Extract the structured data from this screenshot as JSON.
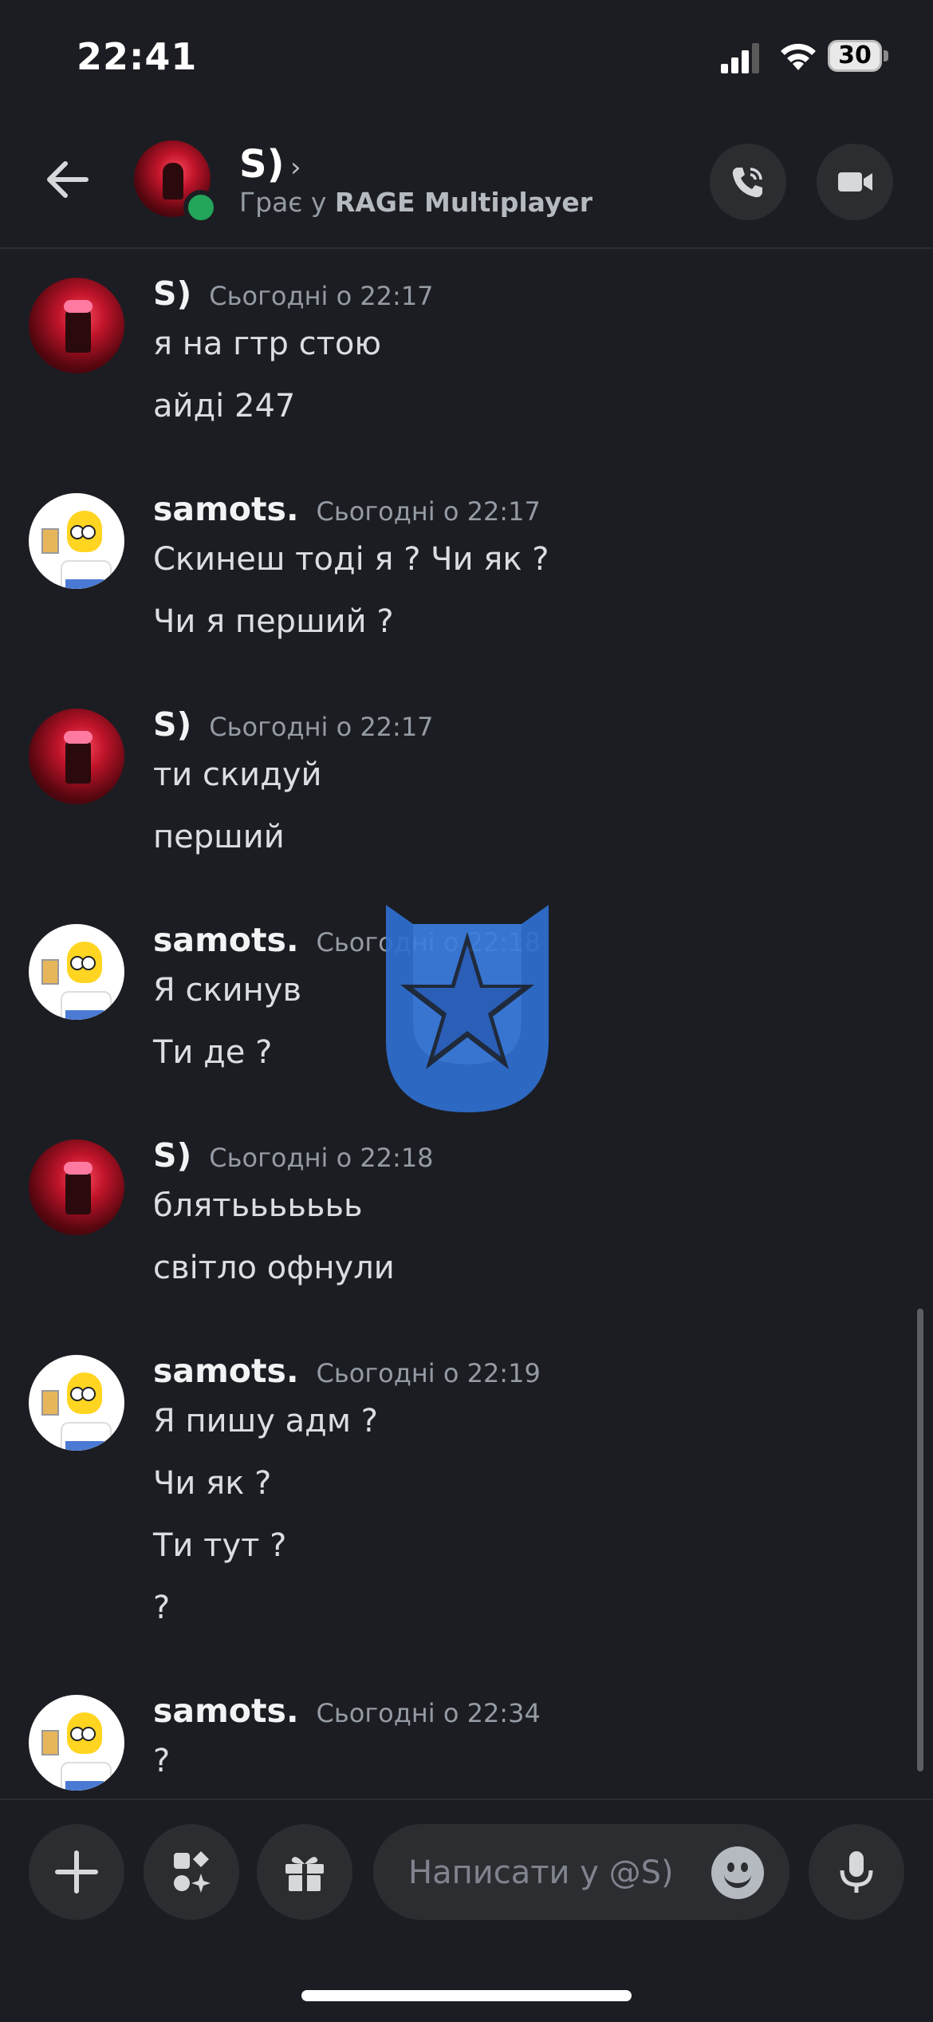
{
  "status_bar": {
    "time": "22:41",
    "battery": "30"
  },
  "header": {
    "name": "S)",
    "activity_prefix": "Грає у ",
    "activity_game": "RAGE Multiplayer"
  },
  "messages": [
    {
      "author": "S)",
      "timestamp": "Сьогодні о 22:17",
      "avatar": "red-avatar",
      "lines": [
        "я на гтр стою",
        "айді 247"
      ]
    },
    {
      "author": "samots.",
      "timestamp": "Сьогодні о 22:17",
      "avatar": "homer-avatar",
      "lines": [
        "Скинеш тоді я ? Чи як ?",
        "Чи я перший ?"
      ]
    },
    {
      "author": "S)",
      "timestamp": "Сьогодні о 22:17",
      "avatar": "red-avatar",
      "lines": [
        "ти скидуй",
        "перший"
      ]
    },
    {
      "author": "samots.",
      "timestamp": "Сьогодні о 22:18",
      "avatar": "homer-avatar",
      "lines": [
        "Я скинув",
        "Ти де ?"
      ]
    },
    {
      "author": "S)",
      "timestamp": "Сьогодні о 22:18",
      "avatar": "red-avatar",
      "lines": [
        "блятььььььь",
        "світло офнули"
      ]
    },
    {
      "author": "samots.",
      "timestamp": "Сьогодні о 22:19",
      "avatar": "homer-avatar",
      "lines": [
        "Я пишу адм ?",
        "Чи як ?",
        "Ти тут ?",
        "?"
      ]
    },
    {
      "author": "samots.",
      "timestamp": "Сьогодні о 22:34",
      "avatar": "homer-avatar",
      "lines": [
        "?"
      ]
    }
  ],
  "composer": {
    "placeholder": "Написати у @S)"
  },
  "icons": {
    "back": "arrow-left-icon",
    "call": "phone-call-icon",
    "video": "video-camera-icon",
    "plus": "plus-icon",
    "apps": "apps-icon",
    "gift": "gift-icon",
    "emoji": "emoji-icon",
    "mic": "microphone-icon"
  },
  "colors": {
    "background": "#1c1d22",
    "online": "#23a55a",
    "overlay_logo": "#2f6fd0"
  }
}
